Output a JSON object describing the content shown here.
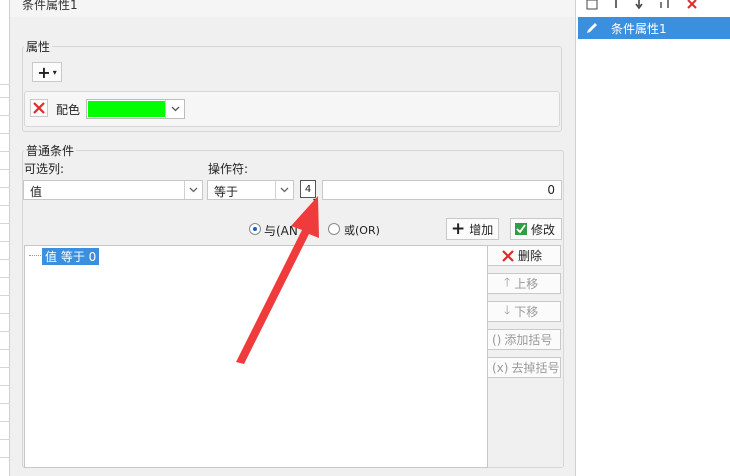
{
  "dialog": {
    "title": "条件属性1"
  },
  "attributes": {
    "legend": "属性",
    "add_button": "+",
    "color_label": "配色",
    "color_value": "#00ff00"
  },
  "conditions": {
    "legend": "普通条件",
    "column_label": "可选列:",
    "column_value": "值",
    "operator_label": "操作符:",
    "operator_value": "等于",
    "param_icon": "4",
    "value": "0",
    "and_label": "与(AND)",
    "or_label": "或(OR)",
    "add_button": "增加",
    "modify_button": "修改",
    "condition_item": "值 等于 0",
    "delete_button": "删除",
    "move_up_button": "上移",
    "move_down_button": "下移",
    "add_bracket_button": "添加括号",
    "remove_bracket_button": "去掉括号"
  },
  "right_panel": {
    "selected_item": "条件属性1"
  },
  "colors": {
    "accent": "#3a8fde",
    "delete_red": "#e02a2a",
    "annotation_arrow": "#ef3b3b"
  }
}
